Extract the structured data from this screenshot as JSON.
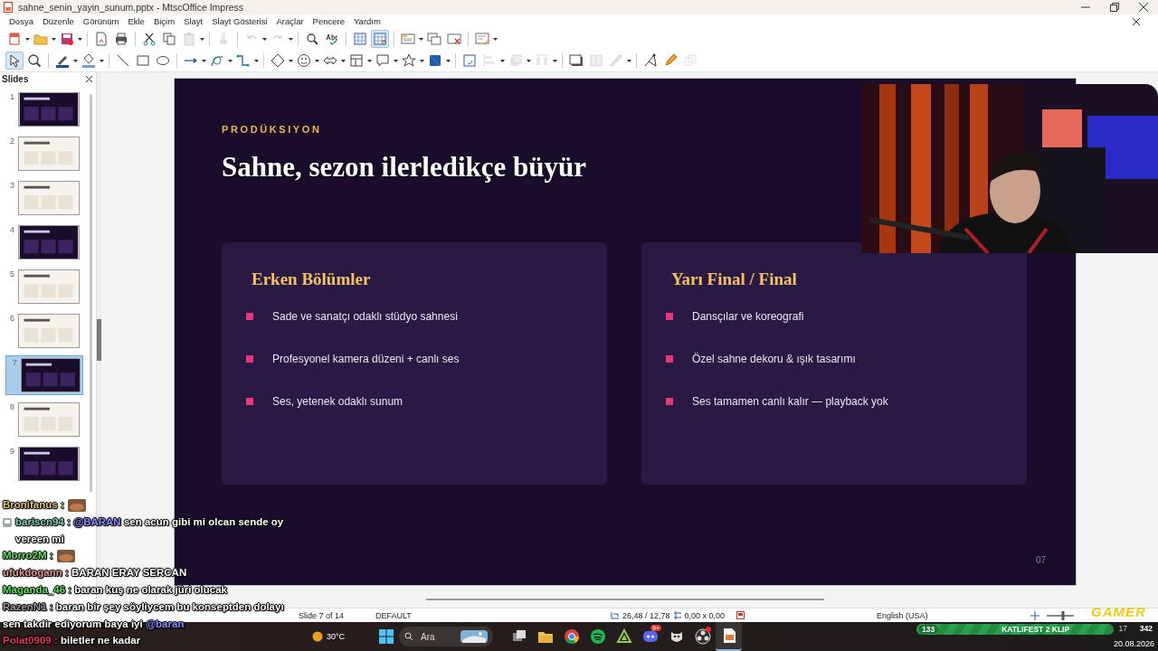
{
  "window": {
    "title": "sahne_senin_yayin_sunum.pptx - MtscOffice Impress"
  },
  "menu": [
    "Dosya",
    "Düzenle",
    "Görünüm",
    "Ekle",
    "Biçim",
    "Slayt",
    "Slayt Gösterisi",
    "Araçlar",
    "Pencere",
    "Yardım"
  ],
  "toolbars": [
    [
      {
        "kind": "new",
        "dropdown": true,
        "pressed": false,
        "disabled": false
      },
      {
        "kind": "open",
        "dropdown": true,
        "pressed": false,
        "disabled": false
      },
      {
        "kind": "save",
        "dropdown": true,
        "pressed": false,
        "disabled": false
      },
      {
        "kind": "separator"
      },
      {
        "kind": "pdf",
        "dropdown": false,
        "pressed": false,
        "disabled": false
      },
      {
        "kind": "print",
        "dropdown": false,
        "pressed": false,
        "disabled": false
      },
      {
        "kind": "separator"
      },
      {
        "kind": "cut",
        "dropdown": false,
        "pressed": false,
        "disabled": false
      },
      {
        "kind": "copy",
        "dropdown": false,
        "pressed": false,
        "disabled": false
      },
      {
        "kind": "paste",
        "dropdown": true,
        "pressed": false,
        "disabled": true
      },
      {
        "kind": "separator"
      },
      {
        "kind": "clone",
        "dropdown": false,
        "pressed": false,
        "disabled": true
      },
      {
        "kind": "separator"
      },
      {
        "kind": "undo",
        "dropdown": true,
        "pressed": false,
        "disabled": true
      },
      {
        "kind": "redo",
        "dropdown": true,
        "pressed": false,
        "disabled": true
      },
      {
        "kind": "separator"
      },
      {
        "kind": "find",
        "dropdown": false,
        "pressed": false,
        "disabled": false
      },
      {
        "kind": "spell",
        "dropdown": false,
        "pressed": false,
        "disabled": false
      },
      {
        "kind": "separator"
      },
      {
        "kind": "grid",
        "dropdown": false,
        "pressed": false,
        "disabled": false
      },
      {
        "kind": "gridfront",
        "dropdown": false,
        "pressed": true,
        "disabled": false
      },
      {
        "kind": "separator"
      },
      {
        "kind": "slide",
        "dropdown": true,
        "pressed": false,
        "disabled": false
      },
      {
        "kind": "duplicate",
        "dropdown": false,
        "pressed": false,
        "disabled": false
      },
      {
        "kind": "delete",
        "dropdown": false,
        "pressed": false,
        "disabled": false
      },
      {
        "kind": "separator"
      },
      {
        "kind": "layout",
        "dropdown": true,
        "pressed": false,
        "disabled": false
      }
    ],
    [
      {
        "kind": "select",
        "dropdown": false,
        "pressed": true,
        "disabled": false
      },
      {
        "kind": "zoom",
        "dropdown": false,
        "pressed": false,
        "disabled": false
      },
      {
        "kind": "separator"
      },
      {
        "kind": "linecolor",
        "dropdown": true,
        "pressed": false,
        "disabled": false
      },
      {
        "kind": "fillcolor",
        "dropdown": true,
        "pressed": false,
        "disabled": false
      },
      {
        "kind": "separator"
      },
      {
        "kind": "line",
        "dropdown": false,
        "pressed": false,
        "disabled": false
      },
      {
        "kind": "rect",
        "dropdown": false,
        "pressed": false,
        "disabled": false
      },
      {
        "kind": "ellipse",
        "dropdown": false,
        "pressed": false,
        "disabled": false
      },
      {
        "kind": "separator"
      },
      {
        "kind": "arrow",
        "dropdown": true,
        "pressed": false,
        "disabled": false
      },
      {
        "kind": "curve",
        "dropdown": true,
        "pressed": false,
        "disabled": false
      },
      {
        "kind": "connector",
        "dropdown": true,
        "pressed": false,
        "disabled": false
      },
      {
        "kind": "separator"
      },
      {
        "kind": "diamond",
        "dropdown": true,
        "pressed": false,
        "disabled": false
      },
      {
        "kind": "smiley",
        "dropdown": true,
        "pressed": false,
        "disabled": false
      },
      {
        "kind": "doublearrow",
        "dropdown": true,
        "pressed": false,
        "disabled": false
      },
      {
        "kind": "flowchart",
        "dropdown": true,
        "pressed": false,
        "disabled": false
      },
      {
        "kind": "callout",
        "dropdown": true,
        "pressed": false,
        "disabled": false
      },
      {
        "kind": "star",
        "dropdown": true,
        "pressed": false,
        "disabled": false
      },
      {
        "kind": "cube",
        "dropdown": true,
        "pressed": false,
        "disabled": false
      },
      {
        "kind": "separator"
      },
      {
        "kind": "rotate",
        "dropdown": false,
        "pressed": false,
        "disabled": false
      },
      {
        "kind": "align",
        "dropdown": true,
        "pressed": false,
        "disabled": true
      },
      {
        "kind": "arrange",
        "dropdown": true,
        "pressed": false,
        "disabled": true
      },
      {
        "kind": "distribute",
        "dropdown": true,
        "pressed": false,
        "disabled": true
      },
      {
        "kind": "separator"
      },
      {
        "kind": "shadow",
        "dropdown": false,
        "pressed": false,
        "disabled": false
      },
      {
        "kind": "crop",
        "dropdown": false,
        "pressed": false,
        "disabled": true
      },
      {
        "kind": "filter",
        "dropdown": true,
        "pressed": false,
        "disabled": true
      },
      {
        "kind": "separator"
      },
      {
        "kind": "points",
        "dropdown": false,
        "pressed": false,
        "disabled": false
      },
      {
        "kind": "glue",
        "dropdown": false,
        "pressed": false,
        "disabled": false
      },
      {
        "kind": "extrusion",
        "dropdown": false,
        "pressed": false,
        "disabled": true
      }
    ]
  ],
  "slides_panel": {
    "title": "Slides",
    "thumbnails": [
      {
        "number": "1",
        "kind": "dark",
        "selected": false
      },
      {
        "number": "2",
        "kind": "light",
        "selected": false
      },
      {
        "number": "3",
        "kind": "light",
        "selected": false
      },
      {
        "number": "4",
        "kind": "dark",
        "selected": false
      },
      {
        "number": "5",
        "kind": "light",
        "selected": false
      },
      {
        "number": "6",
        "kind": "light",
        "selected": false
      },
      {
        "number": "7",
        "kind": "dark",
        "selected": true
      },
      {
        "number": "8",
        "kind": "light",
        "selected": false
      },
      {
        "number": "9",
        "kind": "dark",
        "selected": false
      }
    ]
  },
  "slide": {
    "kicker": "PRODÜKSIYON",
    "title": "Sahne, sezon ilerledikçe büyür",
    "columns": [
      {
        "heading": "Erken Bölümler",
        "bullets": [
          "Sade ve sanatçı odaklı stüdyo sahnesi",
          "Profesyonel kamera düzeni + canlı ses",
          "Ses, yetenek odaklı sunum"
        ]
      },
      {
        "heading": "Yarı Final / Final",
        "bullets": [
          "Dansçılar ve koreografi",
          "Özel sahne dekoru & ışık tasarımı",
          "Ses tamamen canlı kalır — playback yok"
        ]
      }
    ],
    "page_number": "07"
  },
  "chat": [
    {
      "user": "Bronifanus :",
      "color": "#dcc47c",
      "badge": false,
      "kind": "emote"
    },
    {
      "user": "bariscn94 :",
      "color": "#7fd6c2",
      "badge": true,
      "kind": "text",
      "parts": [
        {
          "kind": "mention",
          "text": "@BARAN"
        },
        {
          "kind": "plain",
          "text": "sen acun gibi mi olcan sende oy vereen mi"
        }
      ]
    },
    {
      "user": "Morro2M :",
      "color": "#5fe35f",
      "badge": false,
      "kind": "emote"
    },
    {
      "user": "ufukdogann :",
      "color": "#e39a9a",
      "badge": false,
      "kind": "text",
      "parts": [
        {
          "kind": "plain",
          "text": "BARAN ERAY SERCAN"
        }
      ]
    },
    {
      "user": "Maganda_46 :",
      "color": "#5fe35f",
      "badge": false,
      "kind": "text",
      "parts": [
        {
          "kind": "plain",
          "text": "baran kuş ne olarak jüri olucak"
        }
      ]
    },
    {
      "user": "RazenN1 :",
      "color": "#9a9aa8",
      "badge": false,
      "kind": "text",
      "parts": [
        {
          "kind": "plain",
          "text": "baran bir şey söyliycem bu konseptden dolayı sen takdir ediyorum baya iyi"
        },
        {
          "kind": "mention",
          "text": "@baran"
        }
      ]
    },
    {
      "user": "Polat0909 :",
      "color": "#e8365c",
      "badge": false,
      "kind": "text",
      "parts": [
        {
          "kind": "plain",
          "text": "biletler ne kadar"
        }
      ]
    }
  ],
  "status_bar": {
    "slide_info": "Slide 7 of 14",
    "layout": "DEFAULT",
    "position": "26,48 / 12,78",
    "size": "0,00 x 0,00",
    "language": "English (USA)",
    "zoom": {
      "level": 0.6
    }
  },
  "stream_overlay": {
    "logo": "GAMER",
    "goal": {
      "level": 1,
      "count": "133",
      "title": "KATLIFEST 2 KLIP",
      "target": "342"
    }
  },
  "taskbar": {
    "weather": "30°C",
    "search_placeholder": "Ara",
    "apps": [
      {
        "kind": "taskview",
        "active": false,
        "alert": false
      },
      {
        "kind": "explorer",
        "active": false,
        "alert": false
      },
      {
        "kind": "chrome",
        "active": false,
        "alert": false
      },
      {
        "kind": "spotify",
        "active": false,
        "alert": false
      },
      {
        "kind": "triangle",
        "active": false,
        "alert": false
      },
      {
        "kind": "discord",
        "active": false,
        "badge": "9+",
        "alert": false
      },
      {
        "kind": "owl",
        "active": false,
        "alert": false
      },
      {
        "kind": "obs",
        "active": false,
        "alert": true
      },
      {
        "kind": "impress",
        "active": true,
        "alert": false
      }
    ],
    "clock_time": "17",
    "date": "20.08.2026"
  }
}
